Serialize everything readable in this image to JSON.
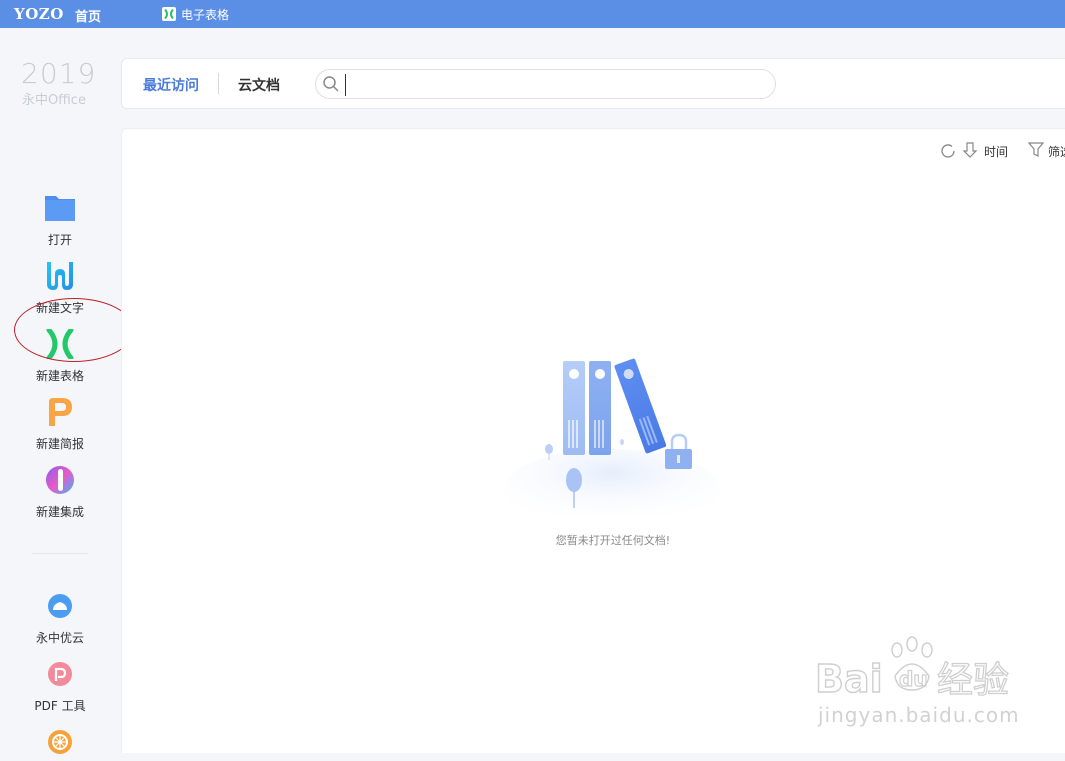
{
  "topbar": {
    "logo": "YOZO",
    "home_label": "首页",
    "tab_label": "电子表格"
  },
  "sidebar": {
    "year": "2019",
    "product": "永中Office",
    "items": [
      {
        "label": "打开"
      },
      {
        "label": "新建文字"
      },
      {
        "label": "新建表格"
      },
      {
        "label": "新建简报"
      },
      {
        "label": "新建集成"
      },
      {
        "label": "永中优云"
      },
      {
        "label": "PDF 工具"
      }
    ]
  },
  "header": {
    "tab_recent": "最近访问",
    "tab_cloud": "云文档",
    "search_value": ""
  },
  "toolbar": {
    "sort_label": "时间",
    "filter_label": "筛选"
  },
  "empty": {
    "message": "您暂未打开过任何文档!"
  },
  "watermark": {
    "url": "jingyan.baidu.com"
  },
  "colors": {
    "topbar": "#5b8fe6",
    "accent": "#4a7bdc",
    "annotation": "#c0202a"
  }
}
